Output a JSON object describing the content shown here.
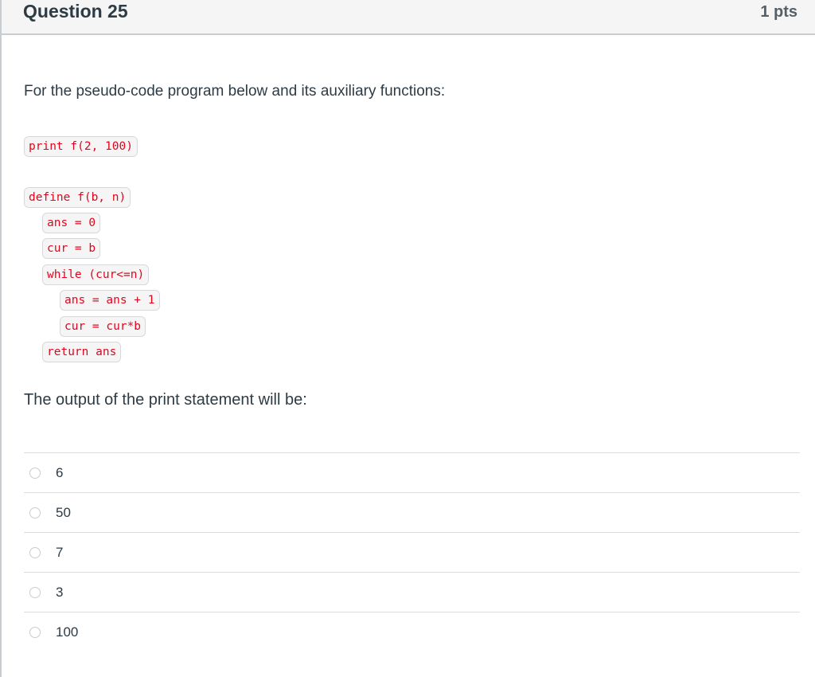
{
  "question": {
    "title": "Question 25",
    "points": "1 pts",
    "intro": "For the pseudo-code program below and its auxiliary functions:",
    "code_lines": [
      {
        "text": "print f(2, 100)",
        "indent": 0
      },
      {
        "text": "define f(b, n)",
        "indent": 0
      },
      {
        "text": "ans = 0",
        "indent": 1
      },
      {
        "text": "cur = b",
        "indent": 1
      },
      {
        "text": "while (cur<=n)",
        "indent": 1
      },
      {
        "text": "ans = ans + 1",
        "indent": 2
      },
      {
        "text": "cur = cur*b",
        "indent": 2
      },
      {
        "text": "return ans",
        "indent": 1
      }
    ],
    "prompt": "The output of the print statement will be:",
    "answers": [
      {
        "label": "6",
        "selected": false
      },
      {
        "label": "50",
        "selected": false
      },
      {
        "label": "7",
        "selected": false
      },
      {
        "label": "3",
        "selected": false
      },
      {
        "label": "100",
        "selected": false
      }
    ]
  },
  "colors": {
    "code_text": "#e0061f",
    "header_bg": "#f5f5f5",
    "text": "#2d3b45"
  }
}
